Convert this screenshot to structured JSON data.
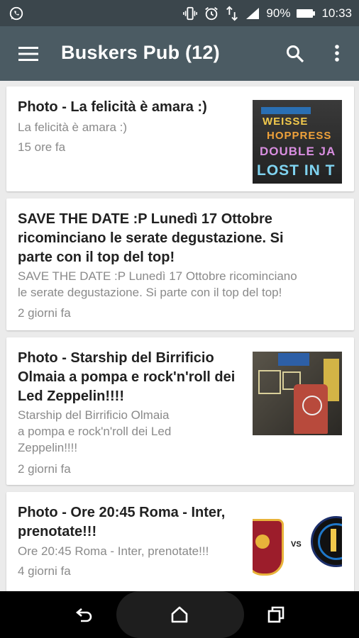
{
  "status": {
    "battery": "90%",
    "time": "10:33"
  },
  "app": {
    "title": "Buskers Pub (12)"
  },
  "feed": [
    {
      "title": "Photo - La felicità è amara :)",
      "description": "La felicità è amara :)",
      "time": "15 ore fa",
      "thumbnail_text": [
        "WEISSE",
        "HOPPRESS",
        "DOUBLE JA",
        "LOST IN T"
      ]
    },
    {
      "title_lines": [
        "SAVE THE DATE :P Lunedì 17 Ottobre",
        "ricominciano le serate degustazione. Si",
        "parte con il top del top!"
      ],
      "description_lines": [
        "SAVE THE DATE :P Lunedì 17 Ottobre ricominciano",
        "le serate degustazione. Si parte con il top del top!"
      ],
      "time": "2 giorni fa"
    },
    {
      "title_lines": [
        "Photo - Starship del Birrificio",
        "Olmaia a pompa e rock'n'roll dei",
        "Led Zeppelin!!!!"
      ],
      "description_lines": [
        "Starship del Birrificio Olmaia",
        "a pompa e rock'n'roll dei Led",
        "Zeppelin!!!!"
      ],
      "time": "2 giorni fa"
    },
    {
      "title_lines": [
        "Photo - Ore 20:45 Roma - Inter,",
        "prenotate!!!"
      ],
      "description": "Ore 20:45 Roma - Inter, prenotate!!!",
      "time": "4 giorni fa",
      "thumbnail_text": "VS"
    }
  ],
  "icons": [
    "whatsapp-icon",
    "vibrate-icon",
    "alarm-icon",
    "data-icon",
    "signal-icon",
    "battery-icon",
    "menu-icon",
    "search-icon",
    "more-vert-icon",
    "back-icon",
    "home-icon",
    "recents-icon"
  ]
}
